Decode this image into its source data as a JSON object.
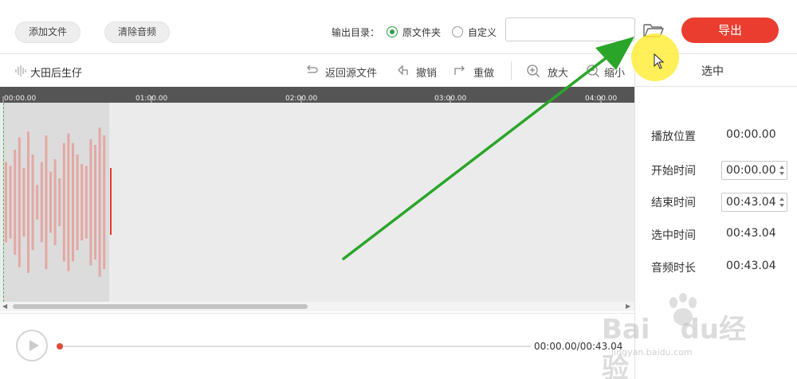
{
  "toolbar": {
    "add_file": "添加文件",
    "clear_audio": "清除音频",
    "output_dir_label": "输出目录：",
    "option_original": "原文件夹",
    "option_custom": "自定义",
    "path_value": "",
    "export_label": "导出"
  },
  "subtoolbar": {
    "track_name": "大田后生仔",
    "revert": "返回源文件",
    "undo": "撤销",
    "redo": "重做",
    "zoom_in": "放大",
    "zoom_out": "缩小"
  },
  "panel": {
    "title": "选中",
    "rows": [
      {
        "label": "播放位置",
        "value": "00:00.00",
        "editable": false
      },
      {
        "label": "开始时间",
        "value": "00:00.00",
        "editable": true
      },
      {
        "label": "结束时间",
        "value": "00:43.04",
        "editable": true
      },
      {
        "label": "选中时间",
        "value": "00:43.04",
        "editable": false
      },
      {
        "label": "音频时长",
        "value": "00:43.04",
        "editable": false
      }
    ]
  },
  "timeline": {
    "ticks": [
      "00:00.00",
      "01:00.00",
      "02:00.00",
      "03:00.00",
      "04:00.00"
    ]
  },
  "playback": {
    "time": "00:00.00/00:43.04"
  },
  "watermark": {
    "brand": "Bai",
    "brand2": "du",
    "brand3": "经验",
    "url": "jingyan.baidu.com"
  },
  "colors": {
    "accent_red": "#ea3d2f",
    "radio_green": "#2ba245",
    "waveform": "#e3a8a4",
    "annotation_arrow": "#2aa52a",
    "cursor_highlight": "#ffec3c"
  },
  "icons": {
    "folder": "folder-open-icon",
    "track": "waveform-icon",
    "revert": "back-arrow-icon",
    "undo": "undo-icon",
    "redo": "redo-icon",
    "zoom_in": "zoom-in-icon",
    "zoom_out": "zoom-out-icon",
    "play": "play-icon"
  }
}
